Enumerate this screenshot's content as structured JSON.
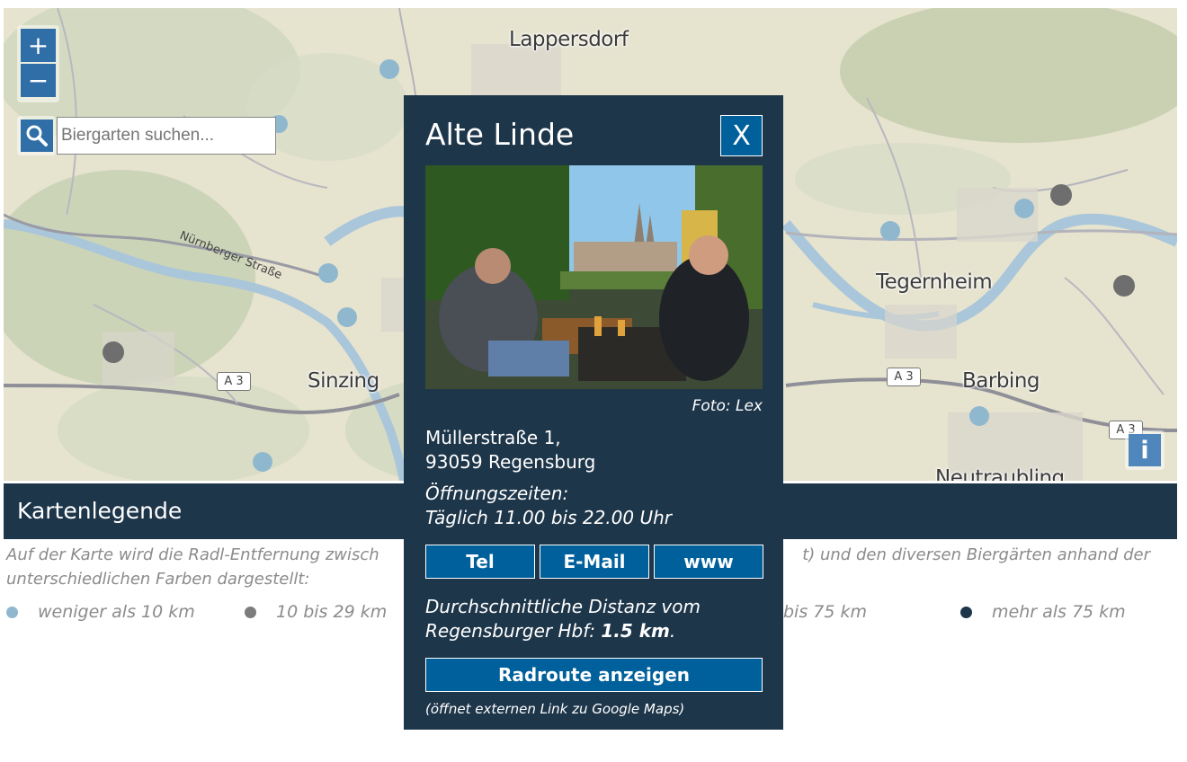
{
  "map": {
    "zoom_in_label": "+",
    "zoom_out_label": "−",
    "search_placeholder": "Biergarten suchen...",
    "info_label": "i",
    "places": [
      "Lappersdorf",
      "Tegernheim",
      "Sinzing",
      "Barbing",
      "Neutraubling"
    ],
    "street_label": "Nürnberger Straße",
    "motorway_label": "A 3"
  },
  "popup": {
    "title": "Alte Linde",
    "close_label": "X",
    "photo_credit": "Foto: Lex",
    "address_line1": "Müllerstraße 1,",
    "address_line2": "93059 Regensburg",
    "hours_label": "Öffnungszeiten:",
    "hours_value": "Täglich 11.00 bis 22.00 Uhr",
    "buttons": [
      "Tel",
      "E-Mail",
      "www"
    ],
    "distance_prefix": "Durchschnittliche Distanz vom",
    "distance_line2": "Regensburger Hbf:",
    "distance_value": "1.5 km",
    "distance_suffix": ".",
    "route_button": "Radroute anzeigen",
    "route_note": "(öffnet externen Link zu Google Maps)"
  },
  "legend": {
    "title": "Kartenlegende",
    "text_left": "Auf der Karte wird die Radl-Entfernung zwisch",
    "text_right": "t) und den diversen Biergärten anhand der",
    "text_line2": "unterschiedlichen Farben dargestellt:",
    "items": [
      {
        "label": "weniger als 10 km",
        "color": "#8fb8cf"
      },
      {
        "label": "10 bis 29 km",
        "color": "#7c7c7c"
      },
      {
        "label": "bis 75 km",
        "color": ""
      },
      {
        "label": "mehr als 75 km",
        "color": "#1e364a"
      }
    ]
  },
  "colors": {
    "panel": "#1e364a",
    "button": "#00609b",
    "map_control": "#2f6ea7",
    "dot_light": "#8fb8cf",
    "dot_grey": "#6e6e6e"
  }
}
